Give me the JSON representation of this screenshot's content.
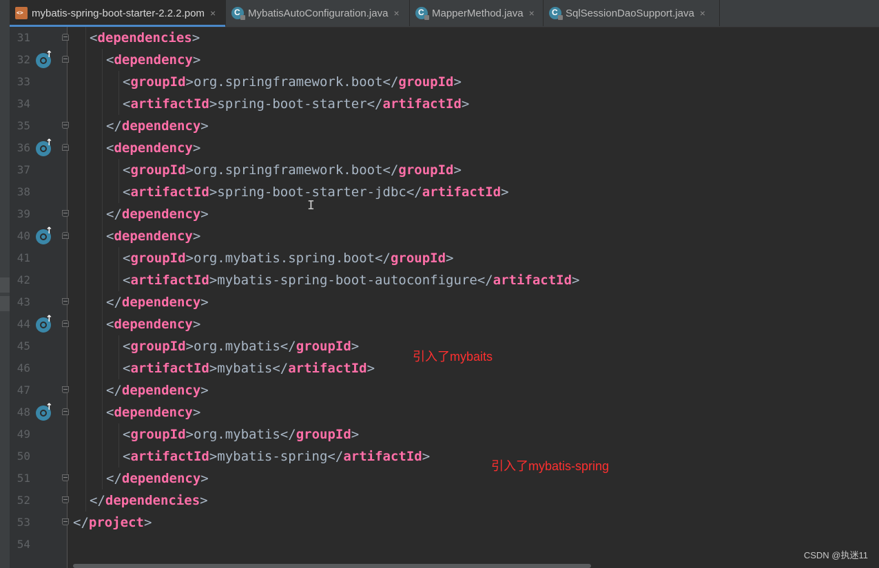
{
  "tabs": [
    {
      "label": "mybatis-spring-boot-starter-2.2.2.pom",
      "icon": "xml-file-icon",
      "active": true
    },
    {
      "label": "MybatisAutoConfiguration.java",
      "icon": "java-class-icon",
      "active": false
    },
    {
      "label": "MapperMethod.java",
      "icon": "java-class-icon",
      "active": false
    },
    {
      "label": "SqlSessionDaoSupport.java",
      "icon": "java-class-icon",
      "active": false
    }
  ],
  "close_glyph": "×",
  "lines": [
    {
      "num": "31",
      "indent": 1,
      "parts": [
        [
          "b",
          "<"
        ],
        [
          "kw",
          "dependencies"
        ],
        [
          "b",
          ">"
        ]
      ],
      "gutter_icon": false,
      "fold": "start"
    },
    {
      "num": "32",
      "indent": 2,
      "parts": [
        [
          "b",
          "<"
        ],
        [
          "kw",
          "dependency"
        ],
        [
          "b",
          ">"
        ]
      ],
      "gutter_icon": true,
      "fold": "start"
    },
    {
      "num": "33",
      "indent": 3,
      "parts": [
        [
          "b",
          "<"
        ],
        [
          "kw",
          "groupId"
        ],
        [
          "b",
          ">org.springframework.boot</"
        ],
        [
          "kw",
          "groupId"
        ],
        [
          "b",
          ">"
        ]
      ],
      "gutter_icon": false,
      "fold": ""
    },
    {
      "num": "34",
      "indent": 3,
      "parts": [
        [
          "b",
          "<"
        ],
        [
          "kw",
          "artifactId"
        ],
        [
          "b",
          ">spring-boot-starter</"
        ],
        [
          "kw",
          "artifactId"
        ],
        [
          "b",
          ">"
        ]
      ],
      "gutter_icon": false,
      "fold": ""
    },
    {
      "num": "35",
      "indent": 2,
      "parts": [
        [
          "b",
          "</"
        ],
        [
          "kw",
          "dependency"
        ],
        [
          "b",
          ">"
        ]
      ],
      "gutter_icon": false,
      "fold": "end"
    },
    {
      "num": "36",
      "indent": 2,
      "parts": [
        [
          "b",
          "<"
        ],
        [
          "kw",
          "dependency"
        ],
        [
          "b",
          ">"
        ]
      ],
      "gutter_icon": true,
      "fold": "start"
    },
    {
      "num": "37",
      "indent": 3,
      "parts": [
        [
          "b",
          "<"
        ],
        [
          "kw",
          "groupId"
        ],
        [
          "b",
          ">org.springframework.boot</"
        ],
        [
          "kw",
          "groupId"
        ],
        [
          "b",
          ">"
        ]
      ],
      "gutter_icon": false,
      "fold": ""
    },
    {
      "num": "38",
      "indent": 3,
      "parts": [
        [
          "b",
          "<"
        ],
        [
          "kw",
          "artifactId"
        ],
        [
          "b",
          ">spring-boot-starter-jdbc</"
        ],
        [
          "kw",
          "artifactId"
        ],
        [
          "b",
          ">"
        ]
      ],
      "gutter_icon": false,
      "fold": ""
    },
    {
      "num": "39",
      "indent": 2,
      "parts": [
        [
          "b",
          "</"
        ],
        [
          "kw",
          "dependency"
        ],
        [
          "b",
          ">"
        ]
      ],
      "gutter_icon": false,
      "fold": "end"
    },
    {
      "num": "40",
      "indent": 2,
      "parts": [
        [
          "b",
          "<"
        ],
        [
          "kw",
          "dependency"
        ],
        [
          "b",
          ">"
        ]
      ],
      "gutter_icon": true,
      "fold": "start"
    },
    {
      "num": "41",
      "indent": 3,
      "parts": [
        [
          "b",
          "<"
        ],
        [
          "kw",
          "groupId"
        ],
        [
          "b",
          ">org.mybatis.spring.boot</"
        ],
        [
          "kw",
          "groupId"
        ],
        [
          "b",
          ">"
        ]
      ],
      "gutter_icon": false,
      "fold": ""
    },
    {
      "num": "42",
      "indent": 3,
      "parts": [
        [
          "b",
          "<"
        ],
        [
          "kw",
          "artifactId"
        ],
        [
          "b",
          ">mybatis-spring-boot-autoconfigure</"
        ],
        [
          "kw",
          "artifactId"
        ],
        [
          "b",
          ">"
        ]
      ],
      "gutter_icon": false,
      "fold": ""
    },
    {
      "num": "43",
      "indent": 2,
      "parts": [
        [
          "b",
          "</"
        ],
        [
          "kw",
          "dependency"
        ],
        [
          "b",
          ">"
        ]
      ],
      "gutter_icon": false,
      "fold": "end"
    },
    {
      "num": "44",
      "indent": 2,
      "parts": [
        [
          "b",
          "<"
        ],
        [
          "kw",
          "dependency"
        ],
        [
          "b",
          ">"
        ]
      ],
      "gutter_icon": true,
      "fold": "start"
    },
    {
      "num": "45",
      "indent": 3,
      "parts": [
        [
          "b",
          "<"
        ],
        [
          "kw",
          "groupId"
        ],
        [
          "b",
          ">org.mybatis</"
        ],
        [
          "kw",
          "groupId"
        ],
        [
          "b",
          ">"
        ]
      ],
      "gutter_icon": false,
      "fold": ""
    },
    {
      "num": "46",
      "indent": 3,
      "parts": [
        [
          "b",
          "<"
        ],
        [
          "kw",
          "artifactId"
        ],
        [
          "b",
          ">mybatis</"
        ],
        [
          "kw",
          "artifactId"
        ],
        [
          "b",
          ">"
        ]
      ],
      "gutter_icon": false,
      "fold": ""
    },
    {
      "num": "47",
      "indent": 2,
      "parts": [
        [
          "b",
          "</"
        ],
        [
          "kw",
          "dependency"
        ],
        [
          "b",
          ">"
        ]
      ],
      "gutter_icon": false,
      "fold": "end"
    },
    {
      "num": "48",
      "indent": 2,
      "parts": [
        [
          "b",
          "<"
        ],
        [
          "kw",
          "dependency"
        ],
        [
          "b",
          ">"
        ]
      ],
      "gutter_icon": true,
      "fold": "start"
    },
    {
      "num": "49",
      "indent": 3,
      "parts": [
        [
          "b",
          "<"
        ],
        [
          "kw",
          "groupId"
        ],
        [
          "b",
          ">org.mybatis</"
        ],
        [
          "kw",
          "groupId"
        ],
        [
          "b",
          ">"
        ]
      ],
      "gutter_icon": false,
      "fold": ""
    },
    {
      "num": "50",
      "indent": 3,
      "parts": [
        [
          "b",
          "<"
        ],
        [
          "kw",
          "artifactId"
        ],
        [
          "b",
          ">mybatis-spring</"
        ],
        [
          "kw",
          "artifactId"
        ],
        [
          "b",
          ">"
        ]
      ],
      "gutter_icon": false,
      "fold": ""
    },
    {
      "num": "51",
      "indent": 2,
      "parts": [
        [
          "b",
          "</"
        ],
        [
          "kw",
          "dependency"
        ],
        [
          "b",
          ">"
        ]
      ],
      "gutter_icon": false,
      "fold": "end"
    },
    {
      "num": "52",
      "indent": 1,
      "parts": [
        [
          "b",
          "</"
        ],
        [
          "kw",
          "dependencies"
        ],
        [
          "b",
          ">"
        ]
      ],
      "gutter_icon": false,
      "fold": "end"
    },
    {
      "num": "53",
      "indent": 0,
      "parts": [
        [
          "b",
          "</"
        ],
        [
          "kw",
          "project"
        ],
        [
          "b",
          ">"
        ]
      ],
      "gutter_icon": false,
      "fold": "end"
    },
    {
      "num": "54",
      "indent": 0,
      "parts": [],
      "gutter_icon": false,
      "fold": ""
    }
  ],
  "annotations": [
    {
      "text": "引入了mybaits"
    },
    {
      "text": "引入了mybatis-spring"
    }
  ],
  "watermark": "CSDN @执迷11",
  "colors": {
    "editor_bg": "#2b2b2b",
    "tag_name": "#ff6fa8",
    "text": "#a9b7c6",
    "line_number": "#606366",
    "annotation": "#ff3030",
    "gutter_icon": "#3a87a8"
  }
}
